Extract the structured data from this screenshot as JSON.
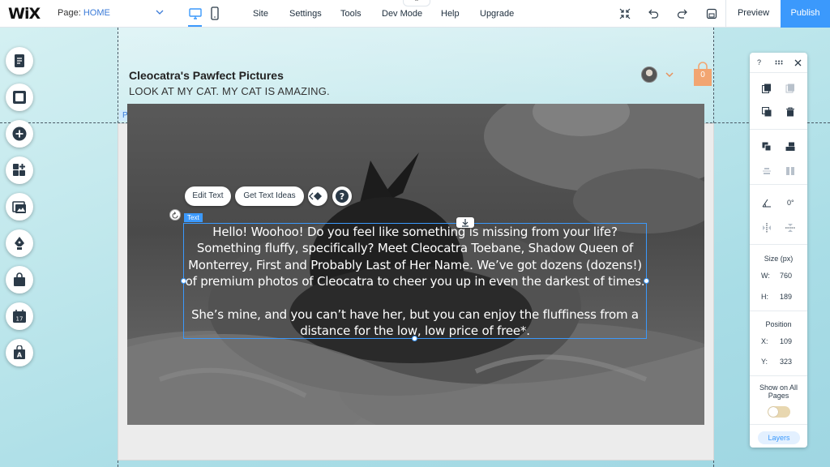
{
  "topbar": {
    "logo": "WiX",
    "page_label": "Page:",
    "page_value": "HOME",
    "menu": [
      "Site",
      "Settings",
      "Tools",
      "Dev Mode",
      "Help",
      "Upgrade"
    ],
    "preview": "Preview",
    "publish": "Publish",
    "nub_glyph": "⌃"
  },
  "site": {
    "title": "Cleocatra's Pawfect Pictures",
    "subtitle": "LOOK AT MY CAT. MY CAT IS AMAZING.",
    "cart_count": "0",
    "page_tag": "Page"
  },
  "text_element": {
    "tag": "Text",
    "edit_text": "Edit Text",
    "get_ideas": "Get Text Ideas",
    "paragraph1": "Hello! Woohoo! Do you feel like something is missing from your life? Something fluffy, specifically? Meet Cleocatra Toebane, Shadow Queen of Monterrey, First and Probably Last of Her Name. We’ve got dozens (dozens!) of premium photos of Cleocatra to cheer you up in even the darkest of times.",
    "paragraph2": "She’s mine, and you can’t have her, but you can enjoy the fluffiness from a distance for the low, low price of free*."
  },
  "panel": {
    "help": "?",
    "rotation_value": "0°",
    "size_label": "Size (px)",
    "w_label": "W:",
    "w_value": "760",
    "h_label": "H:",
    "h_value": "189",
    "position_label": "Position",
    "x_label": "X:",
    "x_value": "109",
    "y_label": "Y:",
    "y_value": "323",
    "show_all_pages": "Show on All Pages",
    "layers": "Layers"
  },
  "left_toolbar": [
    "pages-icon",
    "background-icon",
    "add-icon",
    "apps-icon",
    "media-icon",
    "blog-icon",
    "store-icon",
    "bookings-icon",
    "fonts-icon"
  ]
}
